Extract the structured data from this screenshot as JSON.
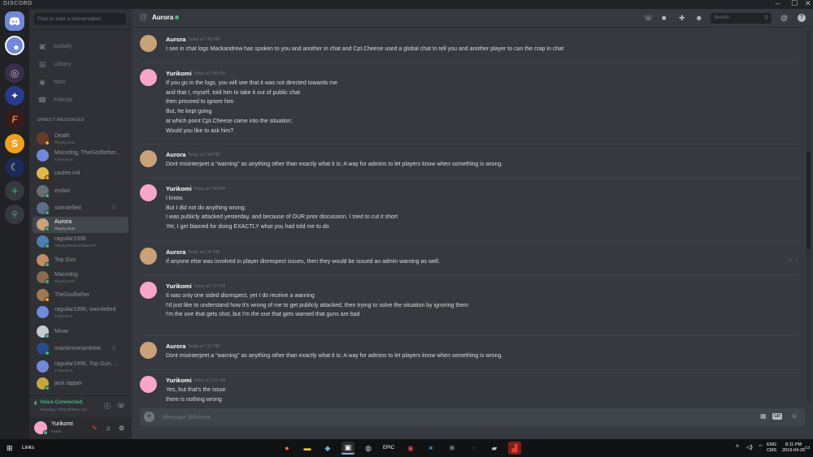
{
  "window": {
    "app_logo_text": "DISCORD",
    "minimize_glyph": "–",
    "maximize_glyph": "☐",
    "close_glyph": "✕"
  },
  "sidebar": {
    "search_placeholder": "Find or start a conversation",
    "nav": [
      {
        "label": "Activity",
        "icon": "gamepad-icon"
      },
      {
        "label": "Library",
        "icon": "library-icon"
      },
      {
        "label": "Nitro",
        "icon": "nitro-icon"
      },
      {
        "label": "Friends",
        "icon": "friends-icon"
      }
    ],
    "dm_header": "DIRECT MESSAGES",
    "dms": [
      {
        "name": "Death",
        "sub": "Playing Rust",
        "status": "#faa61a",
        "avatar": "#6b3a2a"
      },
      {
        "name": "Macedog, TheGodfather...",
        "sub": "3 Members",
        "status": "",
        "avatar": "#7289da"
      },
      {
        "name": "caslee.mil",
        "sub": "",
        "status": "#faa61a",
        "avatar": "#e0b84a"
      },
      {
        "name": "endari",
        "sub": "",
        "status": "#43b581",
        "avatar": "#6a6d73"
      },
      {
        "name": "swindelled",
        "sub": "",
        "status": "#43b581",
        "avatar": "#5a6e8a"
      },
      {
        "name": "Aurora",
        "sub": "Playing Rust",
        "status": "#43b581",
        "avatar": "#c9a27a"
      },
      {
        "name": "raguilar1996",
        "sub": "Playing World of Warcraft",
        "status": "#43b581",
        "avatar": "#4a80b0"
      },
      {
        "name": "Top Gun",
        "sub": "",
        "status": "#43b581",
        "avatar": "#c58a68"
      },
      {
        "name": "Macedog",
        "sub": "Playing Rust",
        "status": "#43b581",
        "avatar": "#8a6a4a"
      },
      {
        "name": "TheGodfather",
        "sub": "",
        "status": "#faa61a",
        "avatar": "#9a7b55"
      },
      {
        "name": "raguilar1996, swindelled",
        "sub": "3 Members",
        "status": "",
        "avatar": "#7289da"
      },
      {
        "name": "Mirax",
        "sub": "",
        "status": "#43b581",
        "avatar": "#c7c9cc"
      },
      {
        "name": "mackinnonandrew",
        "sub": "",
        "status": "#43b581",
        "avatar": "#2a4a8a"
      },
      {
        "name": "raguilar1996, Top Gun, ...",
        "sub": "4 Members",
        "status": "",
        "avatar": "#7289da"
      },
      {
        "name": "jack tapper",
        "sub": "",
        "status": "#43b581",
        "avatar": "#c8a83a"
      }
    ],
    "voice": {
      "title": "Voice Connected",
      "subtitle": "Macedog, TheGodfather, swi..."
    },
    "user": {
      "name": "Yurikomi",
      "tag": "#1656"
    }
  },
  "header": {
    "channel_name": "Aurora",
    "search_placeholder": "Search"
  },
  "messages": [
    {
      "author": "Aurora",
      "time": "Today at 7:45 PM",
      "avatar": "#c9a27a",
      "lines": [
        "I see in chat logs Mackandrew has spoken to you and another in chat and Cpt.Cheese used a global chat to tell you and another player to can the crap in chat"
      ]
    },
    {
      "author": "Yurikomi",
      "time": "Today at 7:45 PM",
      "avatar": "#f7a6c7",
      "lines": [
        "If you go in the logs, you will see that it was not directed towards me",
        "and that I, myself, told him to take it out of public chat",
        "then proceed to ignore him",
        "But, he kept going",
        "at which point Cpt.Cheese came into the situation;",
        "Would you like to ask him?"
      ]
    },
    {
      "author": "Aurora",
      "time": "Today at 7:46 PM",
      "avatar": "#c9a27a",
      "lines": [
        "Dont misinterpret a \"warning\" as anything other than exactly what it is: A way for admins to let players know when something is wrong."
      ]
    },
    {
      "author": "Yurikomi",
      "time": "Today at 7:46 PM",
      "avatar": "#f7a6c7",
      "lines": [
        "I know.",
        "But I did not do anything wrong;",
        "I was publicly attacked yesterday, and because of OUR prior discussion, I tried to cut it short",
        "Yet, I get blamed for doing EXACTLY what you had told me to do"
      ]
    },
    {
      "author": "Aurora",
      "time": "Today at 7:47 PM",
      "avatar": "#c9a27a",
      "lines": [
        "If anyone else was involved in player disrespect issues, then they would be issued an admin warning as well."
      ]
    },
    {
      "author": "Yurikomi",
      "time": "Today at 7:47 PM",
      "avatar": "#f7a6c7",
      "lines": [
        "It was only one sided disrespect, yet I do receive a warning",
        "I'd just like to understand how it's wrong of me to get publicly attacked, then trying to solve the situation by ignoring them",
        "I'm the one that gets shot, but I'm the one that gets warned that guns are bad"
      ]
    },
    {
      "author": "Aurora",
      "time": "Today at 7:51 PM",
      "avatar": "#c9a27a",
      "lines": [
        "Dont misinterpret a \"warning\" as anything other than exactly what it is: A way for admins to let players know when something is wrong."
      ]
    },
    {
      "author": "Yurikomi",
      "time": "Today at 7:51 PM",
      "avatar": "#f7a6c7",
      "lines": [
        "Yes, but that's the issue",
        "there is nothing wrong"
      ]
    }
  ],
  "composer": {
    "placeholder": "Message @Aurora",
    "gif_label": "GIF"
  },
  "taskbar": {
    "links_label": "Links",
    "lang": "ENG",
    "lang_sub": "CMS",
    "time": "8:11 PM",
    "date": "2019-04-26"
  }
}
